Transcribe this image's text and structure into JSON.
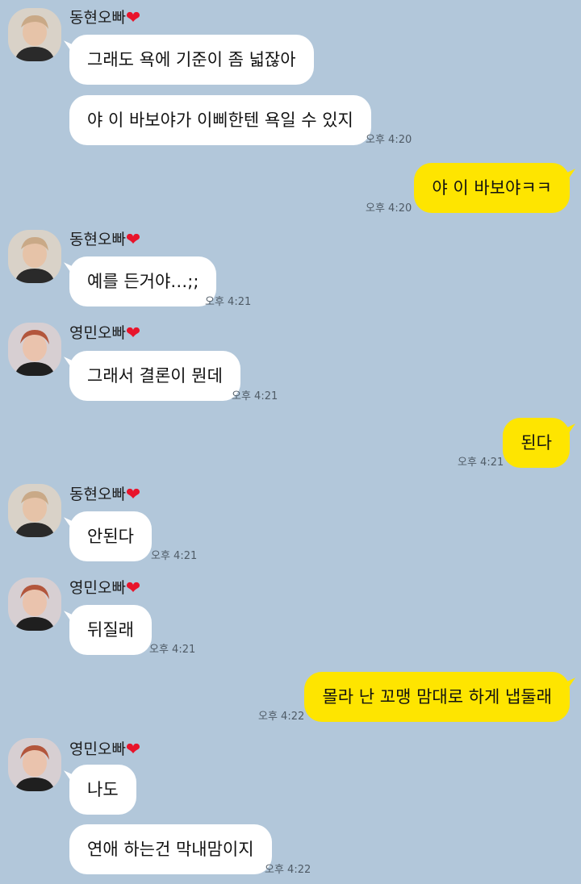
{
  "senders": {
    "donghyun": "동현오빠",
    "youngmin": "영민오빠"
  },
  "heart": "❤",
  "messages": {
    "m1": "그래도 욕에 기준이 좀 넓잖아",
    "m2": "야 이 바보야가 이삐한텐 욕일 수 있지",
    "m3": "야 이 바보야ㅋㅋ",
    "m4": "예를 든거야…;;",
    "m5": "그래서 결론이 뭔데",
    "m6": "된다",
    "m7": "안된다",
    "m8": "뒤질래",
    "m9": "몰라 난 꼬맹 맘대로 하게 냅둘래",
    "m10": "나도",
    "m11": "연애 하는건 막내맘이지"
  },
  "times": {
    "t1": "오후 4:20",
    "t2": "오후 4:20",
    "t3": "오후 4:21",
    "t4": "오후 4:21",
    "t5": "오후 4:21",
    "t6": "오후 4:21",
    "t7": "오후 4:21",
    "t8": "오후 4:22",
    "t9": "오후 4:22"
  },
  "colors": {
    "background": "#b2c7da",
    "incoming_bubble": "#ffffff",
    "outgoing_bubble": "#fee500",
    "heart": "#e8142b"
  },
  "icons": {
    "avatar_donghyun": "profile-photo",
    "avatar_youngmin": "profile-photo"
  }
}
